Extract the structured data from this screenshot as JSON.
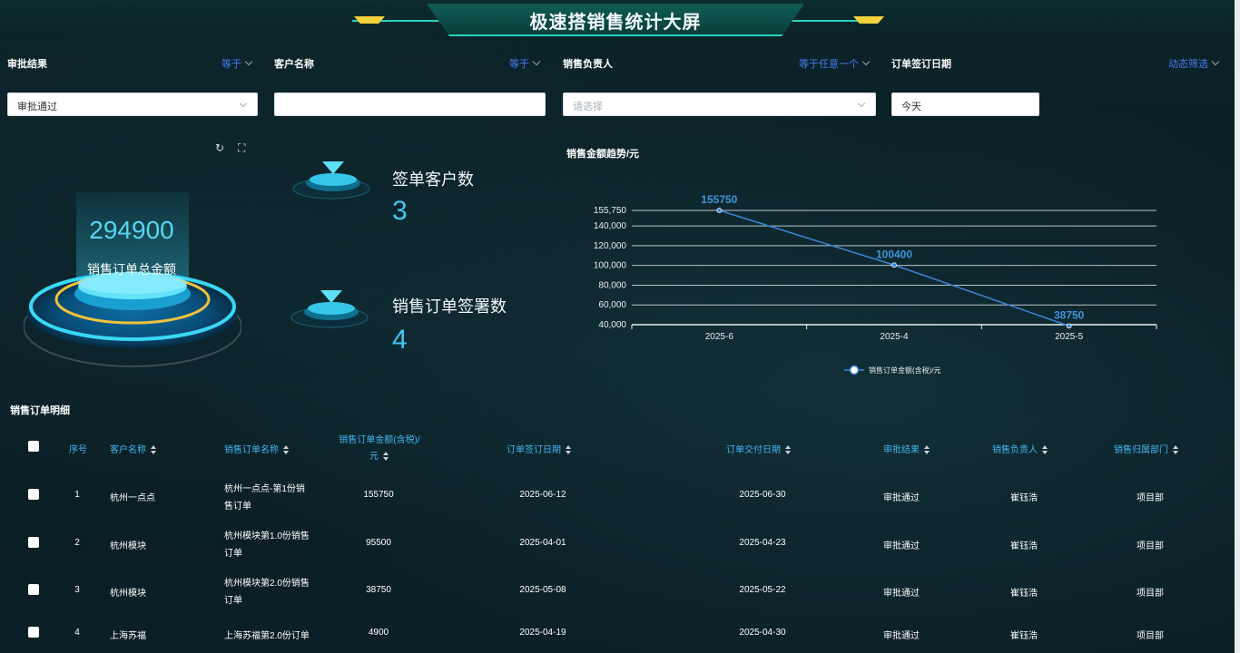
{
  "header": {
    "title": "极速搭销售统计大屏"
  },
  "filters": [
    {
      "label": "审批结果",
      "op": "等于",
      "value": "审批通过",
      "placeholder": ""
    },
    {
      "label": "客户名称",
      "op": "等于",
      "value": "",
      "placeholder": ""
    },
    {
      "label": "销售负责人",
      "op": "等于任意一个",
      "value": "",
      "placeholder": "请选择"
    },
    {
      "label": "订单签订日期",
      "op": "动态筛选",
      "value": "今天",
      "placeholder": ""
    }
  ],
  "summary": {
    "total_amount": "294900",
    "total_label": "销售订单总金额",
    "customers_label": "签单客户数",
    "customers_value": "3",
    "orders_label": "销售订单签署数",
    "orders_value": "4"
  },
  "chart_data": {
    "type": "line",
    "title": "销售金额趋势/元",
    "categories": [
      "2025-6",
      "2025-4",
      "2025-5"
    ],
    "series": [
      {
        "name": "销售订单金额(含税)/元",
        "values": [
          155750,
          100400,
          38750
        ]
      }
    ],
    "ylim": [
      40000,
      155750
    ],
    "yticks": [
      "40,000",
      "60,000",
      "80,000",
      "100,000",
      "120,000",
      "140,000",
      "155,750"
    ],
    "legend_position": "bottom",
    "grid": true,
    "color": "#3a86d4"
  },
  "table": {
    "title": "销售订单明细",
    "columns": [
      "序号",
      "客户名称",
      "销售订单名称",
      "销售订单金额(含税)/",
      "元",
      "订单签订日期",
      "订单交付日期",
      "审批结果",
      "销售负责人",
      "销售归属部门"
    ],
    "rows": [
      {
        "no": "1",
        "customer": "杭州一点点",
        "name1": "杭州一点点-第1份销",
        "name2": "售订单",
        "amount": "155750",
        "sign": "2025-06-12",
        "deliver": "2025-06-30",
        "result": "审批通过",
        "owner": "崔钰浩",
        "dept": "项目部"
      },
      {
        "no": "2",
        "customer": "杭州模块",
        "name1": "杭州模块第1.0份销售",
        "name2": "订单",
        "amount": "95500",
        "sign": "2025-04-01",
        "deliver": "2025-04-23",
        "result": "审批通过",
        "owner": "崔钰浩",
        "dept": "项目部"
      },
      {
        "no": "3",
        "customer": "杭州模块",
        "name1": "杭州模块第2.0份销售",
        "name2": "订单",
        "amount": "38750",
        "sign": "2025-05-08",
        "deliver": "2025-05-22",
        "result": "审批通过",
        "owner": "崔钰浩",
        "dept": "项目部"
      },
      {
        "no": "4",
        "customer": "上海苏福",
        "name1": "上海苏福第2.0份订单",
        "name2": "",
        "amount": "4900",
        "sign": "2025-04-19",
        "deliver": "2025-04-30",
        "result": "审批通过",
        "owner": "崔钰浩",
        "dept": "项目部"
      }
    ]
  },
  "icons": {
    "refresh": "↻",
    "fullscreen": "⛶"
  }
}
